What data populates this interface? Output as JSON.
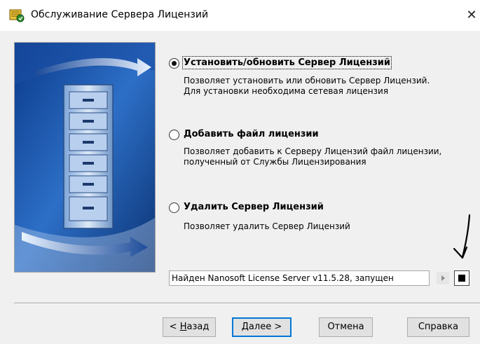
{
  "window": {
    "title": "Обслуживание Сервера Лицензий",
    "close_glyph": "✕",
    "icon": "license-app-icon"
  },
  "options": [
    {
      "label": "Установить/обновить Сервер Лицензий",
      "description": "Позволяет установить или обновить Сервер Лицензий. Для установки необходима сетевая лицензия",
      "selected": true
    },
    {
      "label": "Добавить файл лицензии",
      "description": "Позволяет добавить к Серверу Лицензий файл лицензии, полученный от Службы Лицензирования",
      "selected": false
    },
    {
      "label": "Удалить Сервер Лицензий",
      "description": "Позволяет удалить Сервер Лицензий",
      "selected": false
    }
  ],
  "status": {
    "text": "Найден Nanosoft License Server v11.5.28, запущен",
    "play_icon": "play-icon",
    "stop_icon": "stop-icon"
  },
  "buttons": {
    "back": {
      "prefix": "< ",
      "mnemonic": "Н",
      "rest": "азад"
    },
    "next": {
      "mnemonic": "Д",
      "rest": "алее >"
    },
    "cancel": "Отмена",
    "help": "Справка"
  },
  "colors": {
    "titlebar_bg": "#ffffff",
    "dialog_bg": "#f0f0f0",
    "accent_focus": "#0078d7",
    "panel_blue": "#0b3d8f"
  }
}
